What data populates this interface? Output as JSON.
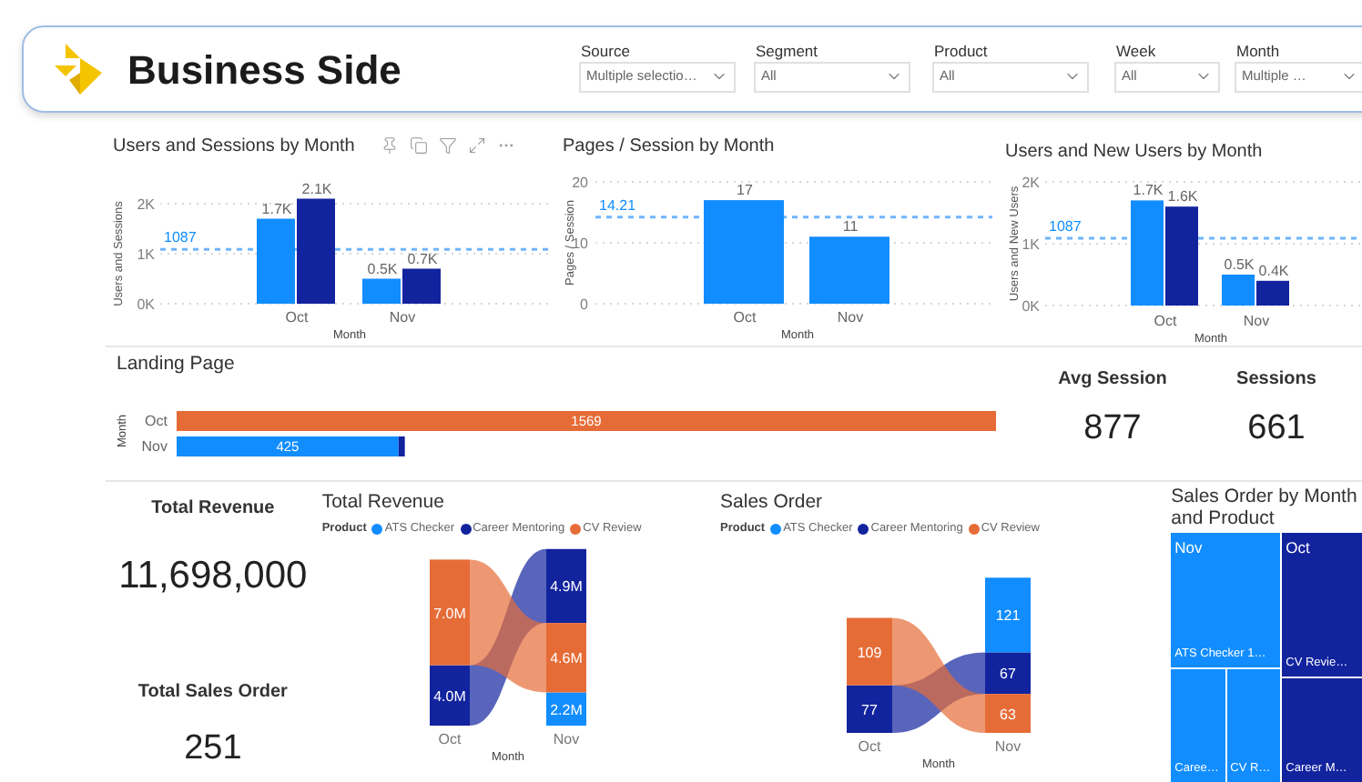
{
  "header": {
    "title": "Business Side",
    "filters": [
      {
        "label": "Source",
        "value": "Multiple selectio…"
      },
      {
        "label": "Segment",
        "value": "All"
      },
      {
        "label": "Product",
        "value": "All"
      },
      {
        "label": "Week",
        "value": "All"
      },
      {
        "label": "Month",
        "value": "Multiple …"
      }
    ]
  },
  "top_charts": [
    {
      "chart_data": {
        "type": "bar",
        "title": "Users and Sessions by Month",
        "xlabel": "Month",
        "ylabel": "Users and Sessions",
        "categories": [
          "Oct",
          "Nov"
        ],
        "series": [
          {
            "color": "#118dff",
            "values": [
              1700,
              500
            ]
          },
          {
            "color": "#12239e",
            "values": [
              2100,
              700
            ]
          }
        ],
        "yticks": [
          {
            "value": 0,
            "label": "0K"
          },
          {
            "value": 1000,
            "label": "1K"
          },
          {
            "value": 2000,
            "label": "2K"
          }
        ],
        "ylim": [
          0,
          2200
        ],
        "value_labels": [
          [
            "1.7K",
            "0.5K"
          ],
          [
            "2.1K",
            "0.7K"
          ]
        ],
        "ref_lines": [
          {
            "axis": "y",
            "value": 1087,
            "label": "1087",
            "color": "#6fb5ff"
          }
        ]
      }
    },
    {
      "chart_data": {
        "type": "bar",
        "title": "Pages / Session by Month",
        "xlabel": "Month",
        "ylabel": "Pages / Session",
        "categories": [
          "Oct",
          "Nov"
        ],
        "series": [
          {
            "color": "#118dff",
            "values": [
              17,
              11
            ]
          }
        ],
        "yticks": [
          0,
          10,
          20
        ],
        "ylim": [
          0,
          20
        ],
        "value_labels": [
          [
            "17",
            "11"
          ]
        ],
        "ref_lines": [
          {
            "axis": "y",
            "value": 14.21,
            "label": "14.21",
            "color": "#6fb5ff"
          }
        ]
      }
    },
    {
      "chart_data": {
        "type": "bar",
        "title": "Users and New Users by Month",
        "xlabel": "Month",
        "ylabel": "Users and New Users",
        "categories": [
          "Oct",
          "Nov"
        ],
        "series": [
          {
            "color": "#118dff",
            "values": [
              1700,
              500
            ]
          },
          {
            "color": "#12239e",
            "values": [
              1600,
              400
            ]
          }
        ],
        "yticks": [
          {
            "value": 0,
            "label": "0K"
          },
          {
            "value": 1000,
            "label": "1K"
          },
          {
            "value": 2000,
            "label": "2K"
          }
        ],
        "ylim": [
          0,
          2000
        ],
        "value_labels": [
          [
            "1.7K",
            "0.5K"
          ],
          [
            "1.6K",
            "0.4K"
          ]
        ],
        "ref_lines": [
          {
            "axis": "y",
            "value": 1087,
            "label": "1087",
            "color": "#6fb5ff"
          }
        ]
      }
    }
  ],
  "landing_page": {
    "chart_data": {
      "type": "bar",
      "title": "Landing Page",
      "orientation": "horizontal",
      "stacked": true,
      "ylabel": "Month",
      "categories": [
        "Oct",
        "Nov"
      ],
      "series": [
        {
          "color": "#e66c37",
          "values": [
            1569,
            null
          ],
          "value_labels": [
            "1569",
            null
          ]
        },
        {
          "color": "#118dff",
          "values": [
            null,
            425
          ],
          "value_labels": [
            null,
            "425"
          ]
        },
        {
          "color": "#12239e",
          "values": [
            null,
            12
          ],
          "value_labels": [
            null,
            null
          ]
        }
      ]
    }
  },
  "cards": [
    {
      "label": "Avg Session",
      "value": "877"
    },
    {
      "label": "Sessions",
      "value": "661"
    }
  ],
  "kpis": [
    {
      "label": "Total Revenue",
      "value": "11,698,000"
    },
    {
      "label": "Total Sales Order",
      "value": "251"
    }
  ],
  "ribbon_charts": [
    {
      "legend_title": "Product",
      "chart_data": {
        "type": "bar",
        "stacked": true,
        "title": "Total Revenue",
        "xlabel": "Month",
        "categories": [
          "Oct",
          "Nov"
        ],
        "series": [
          {
            "name": "ATS Checker",
            "color": "#118dff",
            "values": [
              null,
              2200000
            ],
            "value_labels": [
              null,
              "2.2M"
            ]
          },
          {
            "name": "Career Mentoring",
            "color": "#12239e",
            "values": [
              4000000,
              4900000
            ],
            "value_labels": [
              "4.0M",
              "4.9M"
            ]
          },
          {
            "name": "CV Review",
            "color": "#e66c37",
            "values": [
              7000000,
              4600000
            ],
            "value_labels": [
              "7.0M",
              "4.6M"
            ]
          }
        ]
      }
    },
    {
      "legend_title": "Product",
      "chart_data": {
        "type": "bar",
        "stacked": true,
        "title": "Sales Order",
        "xlabel": "Month",
        "categories": [
          "Oct",
          "Nov"
        ],
        "series": [
          {
            "name": "ATS Checker",
            "color": "#118dff",
            "values": [
              null,
              121
            ]
          },
          {
            "name": "Career Mentoring",
            "color": "#12239e",
            "values": [
              77,
              67
            ]
          },
          {
            "name": "CV Review",
            "color": "#e66c37",
            "values": [
              109,
              63
            ]
          }
        ],
        "data_labels": true
      }
    }
  ],
  "treemap": {
    "title": "Sales Order by Month and Product",
    "groups": [
      {
        "label": "Nov",
        "color": "#118dff",
        "tiles": [
          "ATS Checker 1…",
          "Caree…",
          "CV R…"
        ]
      },
      {
        "label": "Oct",
        "color": "#12239e",
        "tiles": [
          "CV Revie…",
          "Career M…"
        ]
      }
    ]
  }
}
